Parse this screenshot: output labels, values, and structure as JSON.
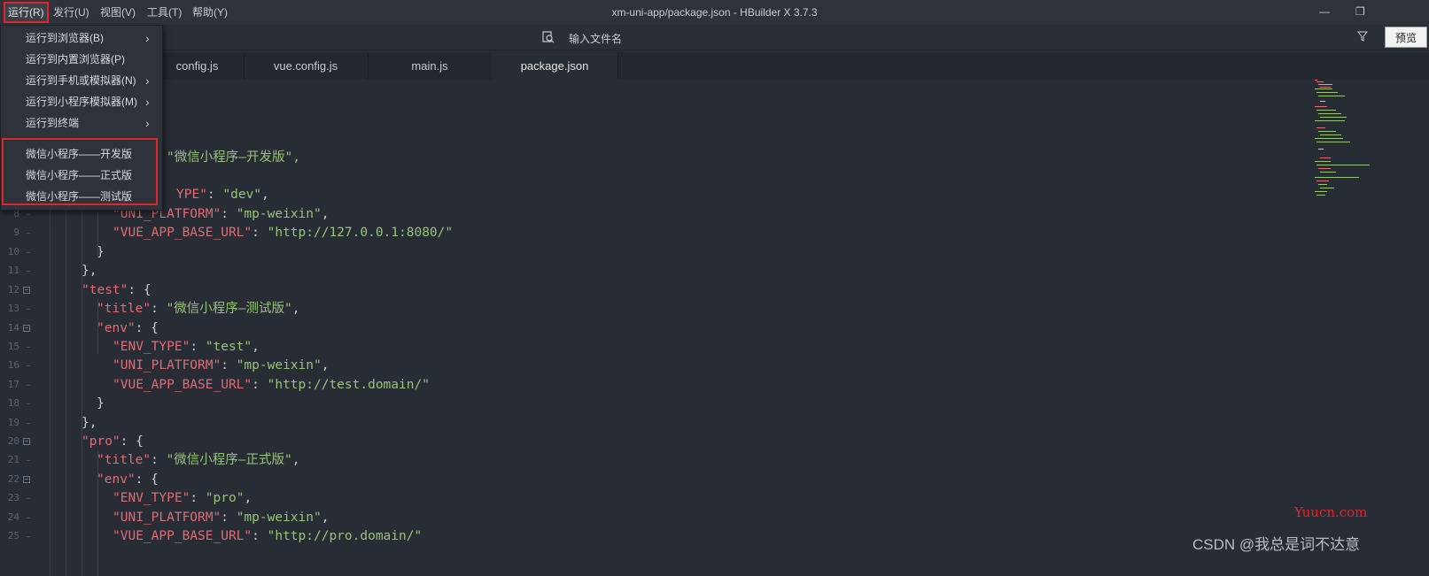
{
  "menubar": {
    "items": [
      {
        "label": "运行(R)"
      },
      {
        "label": "发行(U)"
      },
      {
        "label": "视图(V)"
      },
      {
        "label": "工具(T)"
      },
      {
        "label": "帮助(Y)"
      }
    ]
  },
  "window": {
    "title": "xm-uni-app/package.json - HBuilder X 3.7.3",
    "minimize": "—",
    "restore": "❐"
  },
  "toolbar": {
    "search_placeholder": "输入文件名",
    "preview_label": "预览"
  },
  "tabs": [
    {
      "label": "config.js"
    },
    {
      "label": "vue.config.js"
    },
    {
      "label": "main.js"
    },
    {
      "label": "package.json",
      "active": true
    }
  ],
  "dropdown": {
    "items": [
      {
        "label": "运行到浏览器(B)",
        "has_submenu": true
      },
      {
        "label": "运行到内置浏览器(P)",
        "has_submenu": false
      },
      {
        "label": "运行到手机或模拟器(N)",
        "has_submenu": true
      },
      {
        "label": "运行到小程序模拟器(M)",
        "has_submenu": true
      },
      {
        "label": "运行到终端",
        "has_submenu": true
      },
      {
        "label": "微信小程序——开发版",
        "has_submenu": false
      },
      {
        "label": "微信小程序——正式版",
        "has_submenu": false
      },
      {
        "label": "微信小程序——测试版",
        "has_submenu": false
      }
    ],
    "arrow": "›"
  },
  "editor": {
    "line_numbers": [
      "8",
      "9",
      "10",
      "11",
      "12",
      "13",
      "14",
      "15",
      "16",
      "17",
      "18",
      "19",
      "20",
      "21",
      "22",
      "23",
      "24",
      "25"
    ],
    "fold_marker": "−",
    "lines": [
      {
        "t1": "",
        "k": "",
        "t2": "\"微信小程序—开发版\",",
        "cls": "s"
      },
      {
        "t1": "",
        "k": "YPE\"",
        "t2": ": ",
        "s": "\"dev\"",
        "t3": ","
      },
      {
        "t1": "",
        "k": "\"UNI_PLATFORM\"",
        "t2": ": ",
        "s": "\"mp-weixin\"",
        "t3": ","
      },
      {
        "t1": "",
        "k": "\"VUE_APP_BASE_URL\"",
        "t2": ": ",
        "s": "\"http://127.0.0.1:8080/\"",
        "t3": ""
      },
      {
        "t1": "}",
        "k": "",
        "t2": "",
        "s": "",
        "t3": ""
      },
      {
        "t1": "},",
        "k": "",
        "t2": "",
        "s": "",
        "t3": ""
      },
      {
        "t1": "",
        "k": "\"test\"",
        "t2": ": {",
        "s": "",
        "t3": ""
      },
      {
        "t1": "",
        "k": "\"title\"",
        "t2": ": ",
        "s": "\"微信小程序—测试版\"",
        "t3": ","
      },
      {
        "t1": "",
        "k": "\"env\"",
        "t2": ": {",
        "s": "",
        "t3": ""
      },
      {
        "t1": "",
        "k": "\"ENV_TYPE\"",
        "t2": ": ",
        "s": "\"test\"",
        "t3": ","
      },
      {
        "t1": "",
        "k": "\"UNI_PLATFORM\"",
        "t2": ": ",
        "s": "\"mp-weixin\"",
        "t3": ","
      },
      {
        "t1": "",
        "k": "\"VUE_APP_BASE_URL\"",
        "t2": ": ",
        "s": "\"http://test.domain/\"",
        "t3": ""
      },
      {
        "t1": "}",
        "k": "",
        "t2": "",
        "s": "",
        "t3": ""
      },
      {
        "t1": "},",
        "k": "",
        "t2": "",
        "s": "",
        "t3": ""
      },
      {
        "t1": "",
        "k": "\"pro\"",
        "t2": ": {",
        "s": "",
        "t3": ""
      },
      {
        "t1": "",
        "k": "\"title\"",
        "t2": ": ",
        "s": "\"微信小程序—正式版\"",
        "t3": ","
      },
      {
        "t1": "",
        "k": "\"env\"",
        "t2": ": {",
        "s": "",
        "t3": ""
      },
      {
        "t1": "",
        "k": "\"ENV_TYPE\"",
        "t2": ": ",
        "s": "\"pro\"",
        "t3": ","
      },
      {
        "t1": "",
        "k": "\"UNI_PLATFORM\"",
        "t2": ": ",
        "s": "\"mp-weixin\"",
        "t3": ","
      },
      {
        "t1": "",
        "k": "\"VUE_APP_BASE_URL\"",
        "t2": ": ",
        "s": "\"http://pro.domain/\"",
        "t3": ""
      }
    ]
  },
  "watermarks": {
    "site": "Yuucn.com",
    "author": "CSDN @我总是词不达意"
  },
  "colors": {
    "key": "#e06c75",
    "string": "#98c379",
    "highlight_border": "#e0262a"
  }
}
